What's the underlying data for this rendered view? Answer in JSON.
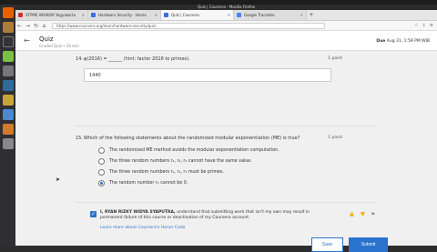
{
  "window": {
    "title": "Quiz | Coursera - Mozilla Firefox"
  },
  "tabs": [
    {
      "label": "STPME AKAKOM Yogyakarta",
      "color": "#c33"
    },
    {
      "label": "Hardware Security - Home",
      "color": "#3a6fd8"
    },
    {
      "label": "Quiz | Coursera",
      "color": "#3a6fd8",
      "active": true
    },
    {
      "label": "Google Translate",
      "color": "#4285f4"
    }
  ],
  "nav": {
    "url": "https://www.coursera.org/learn/hardware-security/quiz"
  },
  "quiz": {
    "title": "Quiz",
    "subtitle": "Graded Quiz • 30 min",
    "due_label": "Due",
    "due_value": "Aug 31, 1:59 PM WIB"
  },
  "q14": {
    "number": "14.",
    "text": "φ(2016) = ______ (hint: factor 2016 to primes).",
    "points": "1 point",
    "answer": "1440"
  },
  "q15": {
    "number": "15.",
    "text": "Which of the following statements about the randomized modular exponentiation (ME) is true?",
    "points": "1 point",
    "options": [
      {
        "label": "The randomized ME method avoids the modular exponentiation computation.",
        "selected": false
      },
      {
        "label": "The three random numbers r₁, r₂, r₃ cannot have the same value.",
        "selected": false
      },
      {
        "label": "The three random numbers r₁, r₂, r₃ must be primes.",
        "selected": false
      },
      {
        "label": "The random number r₃ cannot be 0.",
        "selected": true
      }
    ]
  },
  "honor": {
    "name": "I, RYAN RIZKY WIDYA SYAPUTRA,",
    "text": " understand that submitting work that isn't my own may result in permanent failure of this course or deactivation of my Coursera account.",
    "link": "Learn more about Coursera's Honor Code"
  },
  "buttons": {
    "save": "Save",
    "submit": "Submit"
  }
}
